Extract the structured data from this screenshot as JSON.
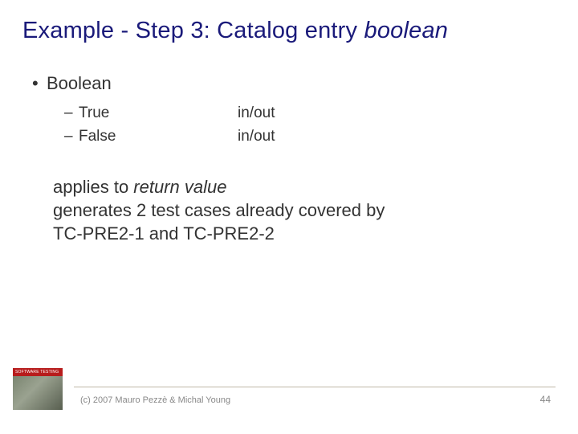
{
  "title": {
    "prefix": "Example - Step 3: Catalog entry ",
    "italic": "boolean"
  },
  "bullet1": {
    "dot": "•",
    "label": "Boolean"
  },
  "sub": {
    "dash": "–",
    "rows": [
      {
        "label": "True",
        "val": "in/out"
      },
      {
        "label": "False",
        "val": "in/out"
      }
    ]
  },
  "body": {
    "line1_prefix": "applies to ",
    "line1_italic": "return value",
    "line2": "generates 2 test cases already covered by",
    "line3": "TC-PRE2-1 and TC-PRE2-2"
  },
  "footer": {
    "copyright": "(c) 2007 Mauro Pezzè & Michal Young",
    "page": "44",
    "thumb_bar": "SOFTWARE TESTING"
  }
}
